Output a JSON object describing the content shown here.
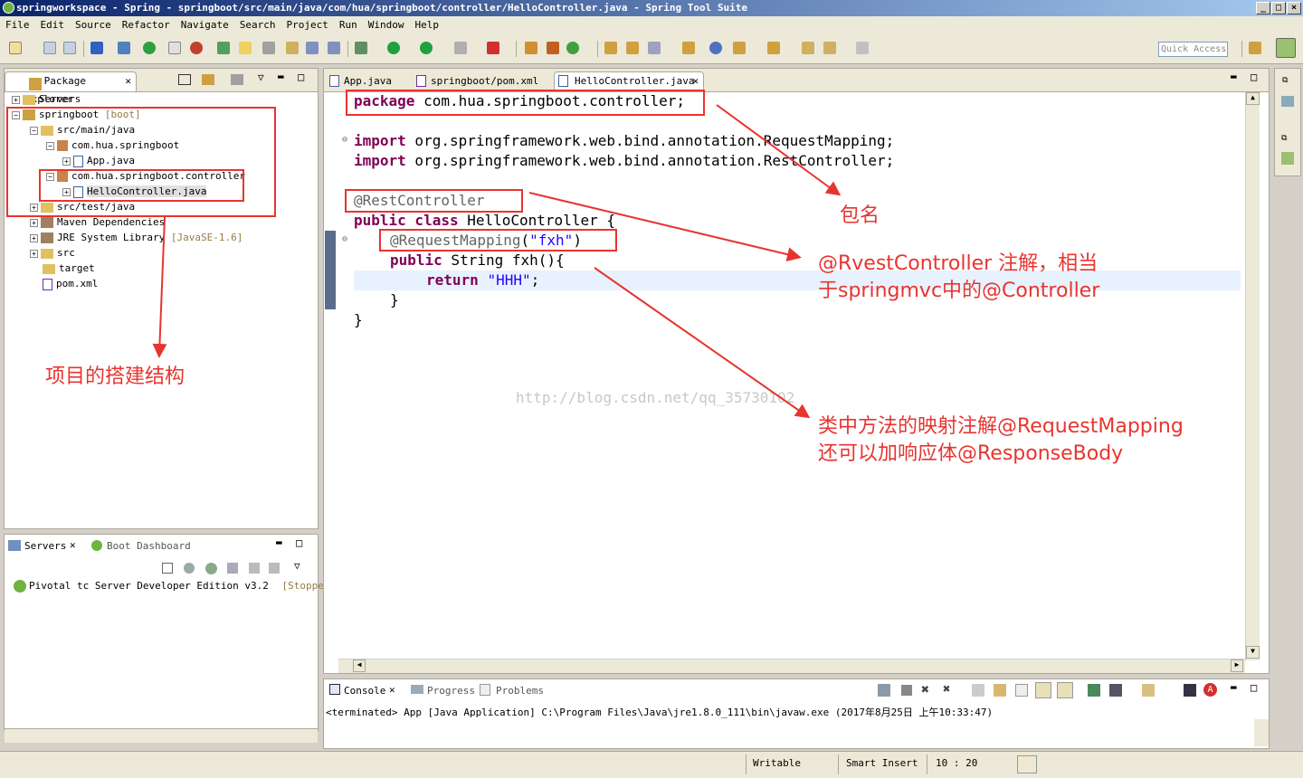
{
  "window": {
    "title": "springworkspace - Spring - springboot/src/main/java/com/hua/springboot/controller/HelloController.java - Spring Tool Suite"
  },
  "menu": [
    "File",
    "Edit",
    "Source",
    "Refactor",
    "Navigate",
    "Search",
    "Project",
    "Run",
    "Window",
    "Help"
  ],
  "quick_access": "Quick Access",
  "package_explorer": {
    "tab": "Package Explorer",
    "items": [
      {
        "label": "Servers",
        "extra": ""
      },
      {
        "label": "springboot",
        "extra": "[boot]"
      },
      {
        "label": "src/main/java",
        "extra": ""
      },
      {
        "label": "com.hua.springboot",
        "extra": ""
      },
      {
        "label": "App.java",
        "extra": ""
      },
      {
        "label": "com.hua.springboot.controller",
        "extra": ""
      },
      {
        "label": "HelloController.java",
        "extra": ""
      },
      {
        "label": "src/test/java",
        "extra": ""
      },
      {
        "label": "Maven Dependencies",
        "extra": ""
      },
      {
        "label": "JRE System Library",
        "extra": "[JavaSE-1.6]"
      },
      {
        "label": "src",
        "extra": ""
      },
      {
        "label": "target",
        "extra": ""
      },
      {
        "label": "pom.xml",
        "extra": ""
      }
    ]
  },
  "servers_panel": {
    "tab1": "Servers",
    "tab2": "Boot Dashboard",
    "server": "Pivotal tc Server Developer Edition v3.2",
    "status": "[Stopped"
  },
  "editor": {
    "tabs": [
      "App.java",
      "springboot/pom.xml",
      "HelloController.java"
    ],
    "code": {
      "l1_kw": "package",
      "l1_rest": " com.hua.springboot.controller;",
      "l2_kw": "import",
      "l2_rest": " org.springframework.web.bind.annotation.RequestMapping;",
      "l3_kw": "import",
      "l3_rest": " org.springframework.web.bind.annotation.RestController;",
      "l4_an": "@RestController",
      "l5_kw": "public class",
      "l5_rest": " HelloController {",
      "l6_an": "@RequestMapping",
      "l6_p1": "(",
      "l6_str": "\"fxh\"",
      "l6_p2": ")",
      "l7_kw": "public",
      "l7_rest": " String fxh(){",
      "l8_kw": "return",
      "l8_sp": " ",
      "l8_str": "\"HHH\"",
      "l8_rest": ";",
      "l9": "}",
      "l10": "}"
    },
    "watermark": "http://blog.csdn.net/qq_35730102"
  },
  "annotations": {
    "package_name": "包名",
    "rest_controller_l1": "@RvestController 注解，相当",
    "rest_controller_l2": "于springmvc中的@Controller",
    "request_mapping_l1": "类中方法的映射注解@RequestMapping",
    "request_mapping_l2": "还可以加响应体@ResponseBody",
    "project_structure": "项目的搭建结构"
  },
  "console": {
    "tabs": [
      "Console",
      "Progress",
      "Problems"
    ],
    "line": "<terminated> App [Java Application] C:\\Program Files\\Java\\jre1.8.0_111\\bin\\javaw.exe (2017年8月25日 上午10:33:47)"
  },
  "statusbar": {
    "writable": "Writable",
    "insert": "Smart Insert",
    "position": "10 : 20"
  },
  "colors": {
    "annotation_red": "#e8342f",
    "keyword": "#7f0055",
    "string": "#2a00ff",
    "annotation": "#646464",
    "title_bar": "#0a246a"
  }
}
